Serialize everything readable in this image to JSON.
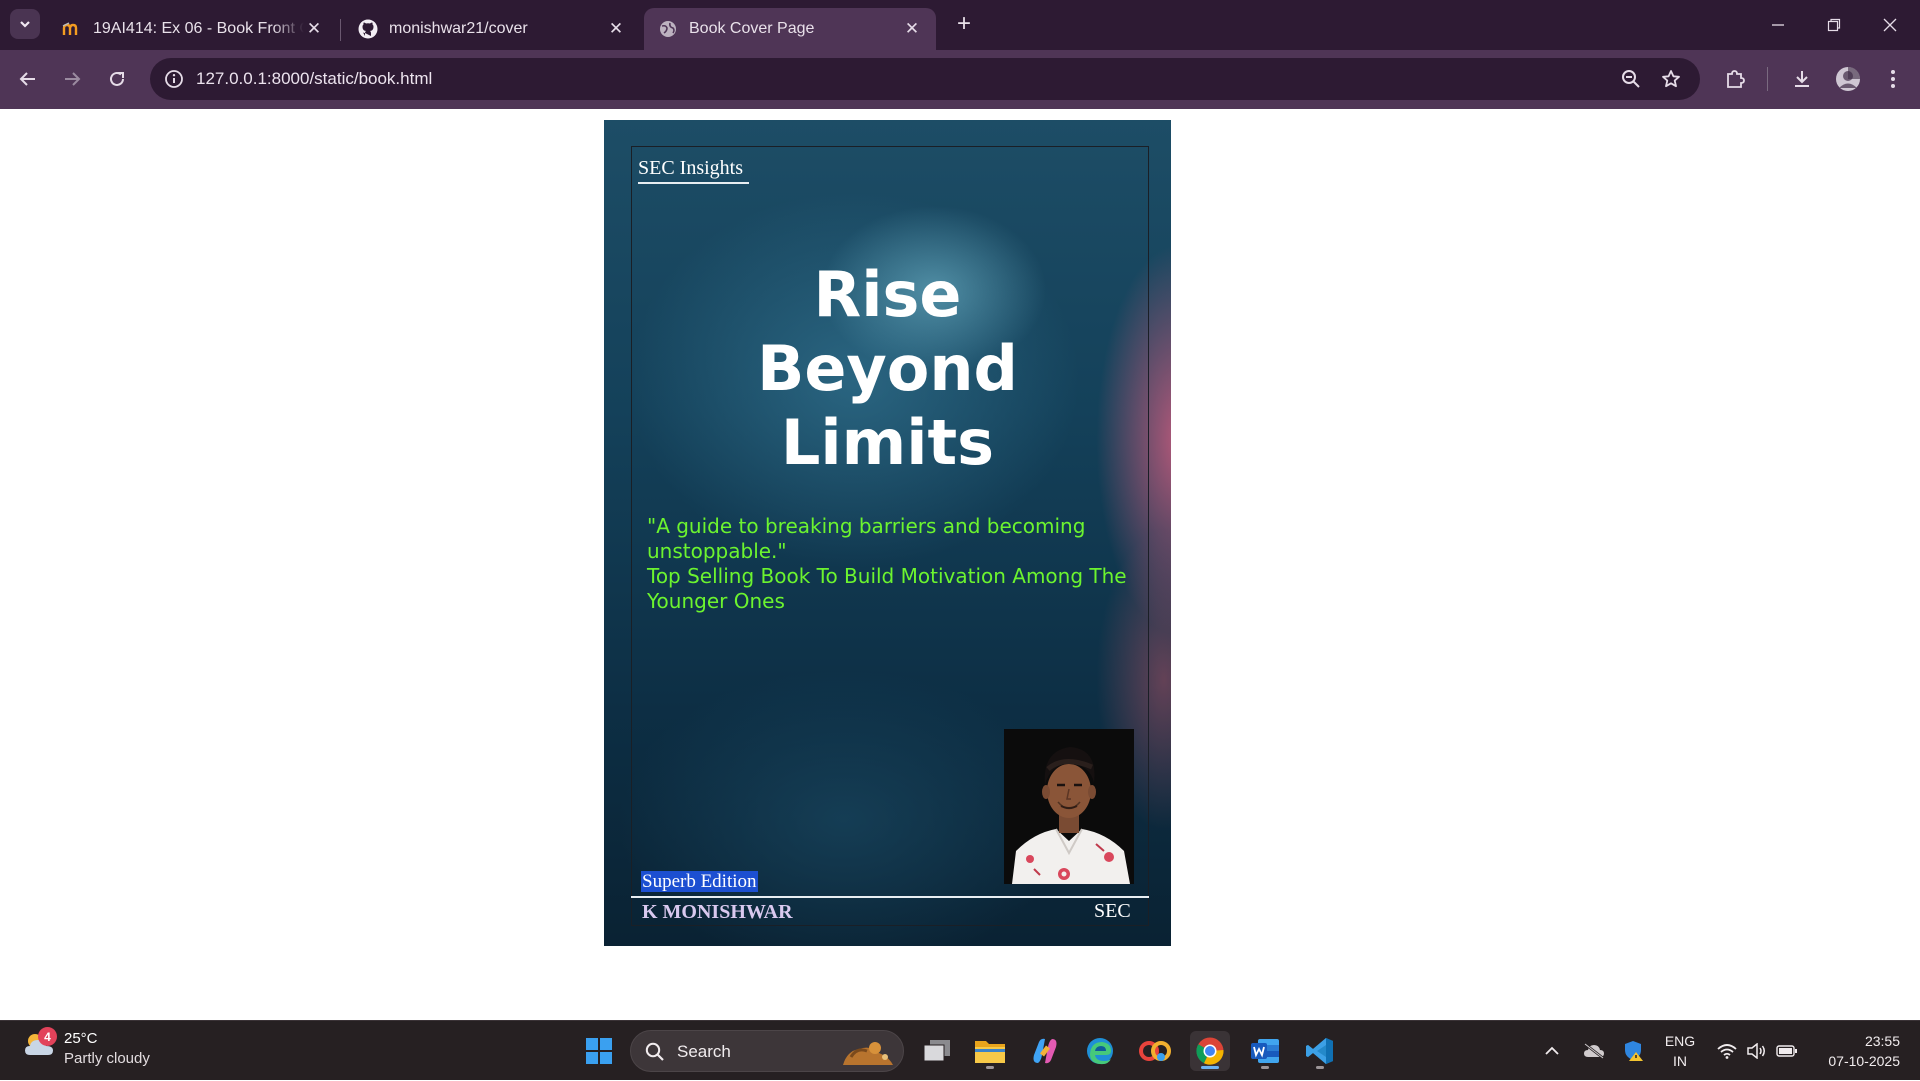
{
  "browser": {
    "tabs": [
      {
        "title": "19AI414: Ex 06 - Book Front Co",
        "favicon": "moodle-icon"
      },
      {
        "title": "monishwar21/cover",
        "favicon": "github-icon"
      },
      {
        "title": "Book Cover Page",
        "favicon": "globe-icon",
        "active": true
      }
    ],
    "url": "127.0.0.1:8000/static/book.html"
  },
  "cover": {
    "publisher": "SEC Insights",
    "title_line1": "Rise",
    "title_line2": "Beyond",
    "title_line3": "Limits",
    "tagline_quote": "\"A guide to breaking barriers and becoming unstoppable.\"",
    "tagline_sub": "Top Selling Book To Build Motivation Among The Younger Ones",
    "edition": "Superb Edition",
    "author": "K MONISHWAR",
    "footer_publisher": "SEC"
  },
  "taskbar": {
    "weather_badge": "4",
    "weather_temp": "25°C",
    "weather_desc": "Partly cloudy",
    "search_placeholder": "Search",
    "lang_line1": "ENG",
    "lang_line2": "IN",
    "time": "23:55",
    "date": "07-10-2025"
  },
  "colors": {
    "tagline": "#6cf42f",
    "edition_highlight": "#1c4fd1",
    "author": "#d9c9ef"
  }
}
